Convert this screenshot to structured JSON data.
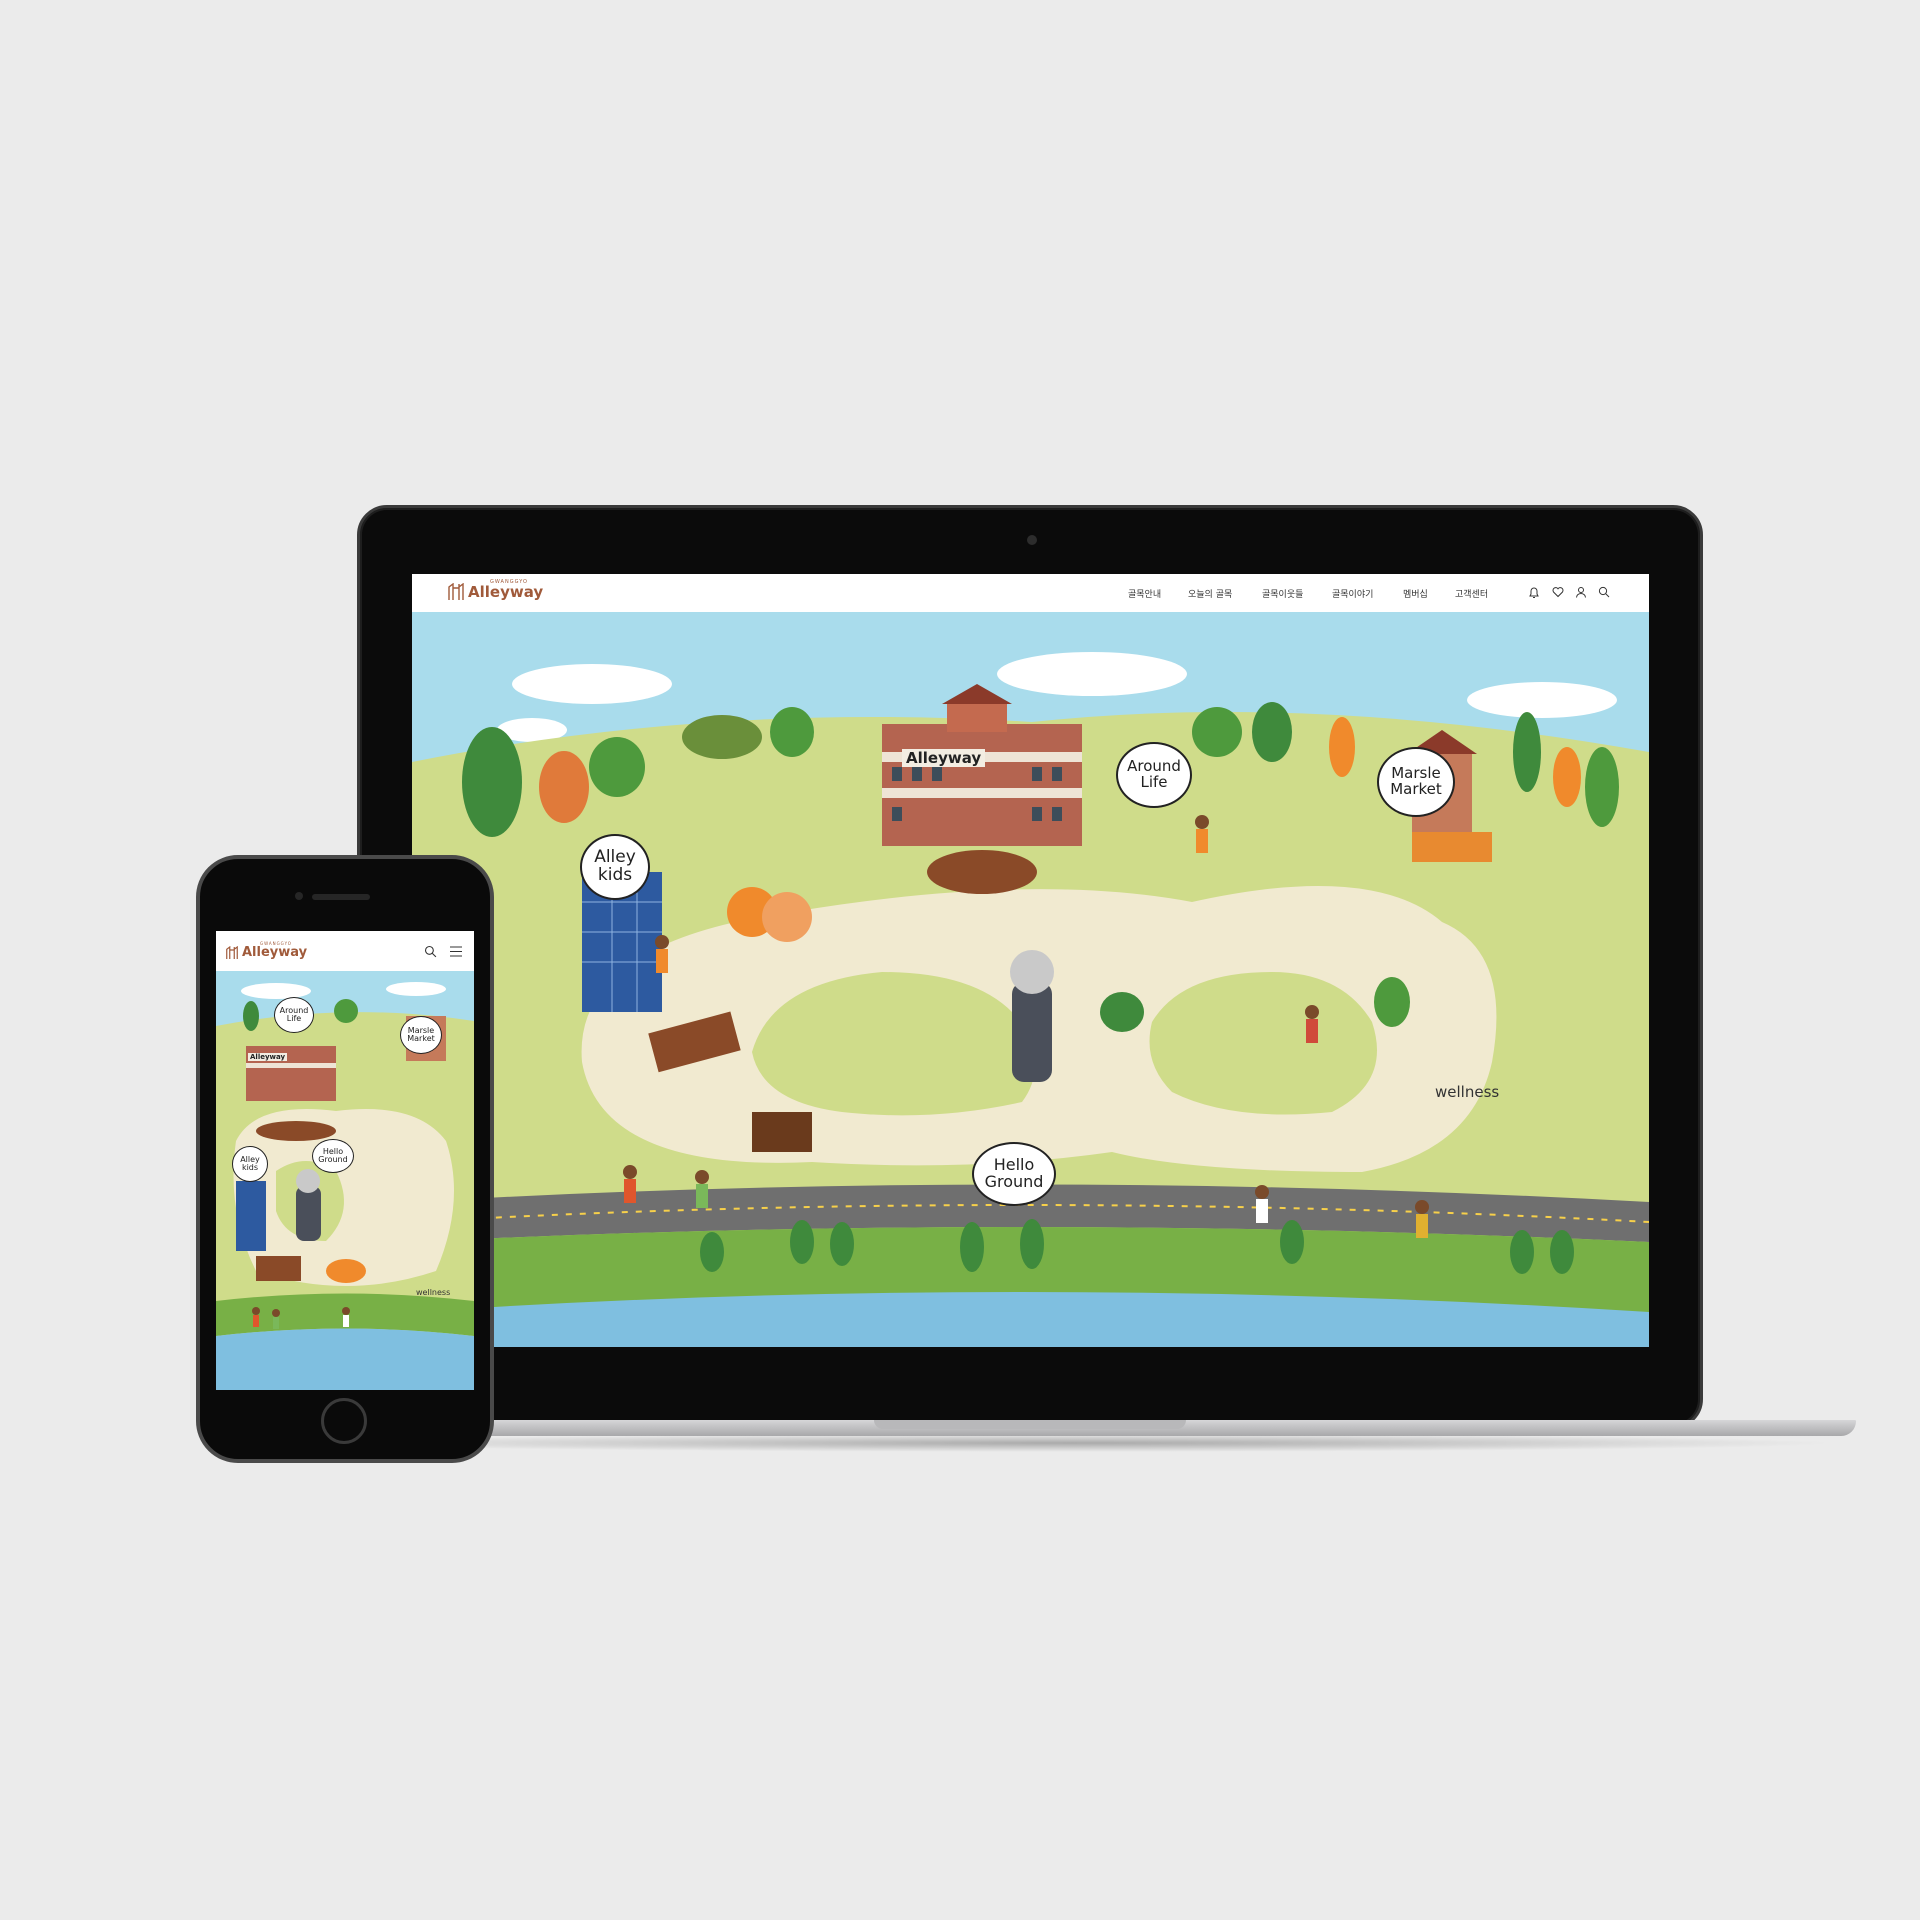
{
  "desktop": {
    "logo": {
      "subtitle": "GWANGGYO",
      "wordmark": "Alleyway"
    },
    "nav_items": [
      "골목안내",
      "오늘의 골목",
      "골목이웃들",
      "골목이야기",
      "멤버십",
      "고객센터"
    ],
    "nav_icons": [
      "bell-icon",
      "heart-icon",
      "user-icon",
      "search-icon"
    ],
    "map_labels": {
      "building_sign": "Alleyway",
      "around_life": "Around\nLife",
      "marsle_market": "Marsle\nMarket",
      "alley_kids": "Alley\nkids",
      "hello_ground": "Hello\nGround",
      "wellness": "wellness"
    }
  },
  "mobile": {
    "logo": {
      "subtitle": "GWANGGYO",
      "wordmark": "Alleyway"
    },
    "nav_icons": [
      "search-icon",
      "menu-icon"
    ],
    "map_labels": {
      "building_sign": "Alleyway",
      "around_life": "Around\nLife",
      "marsle_market": "Marsle\nMarket",
      "alley_kids": "Alley\nkids",
      "hello_ground": "Hello\nGround",
      "wellness": "wellness"
    }
  },
  "colors": {
    "brand": "#a05a3a",
    "sky": "#a9dcec",
    "grass": "#cfdc8a",
    "path": "#f1ead0",
    "road": "#6f6f6f",
    "water": "#7fbfe0",
    "accent_orange": "#f08a2c"
  }
}
